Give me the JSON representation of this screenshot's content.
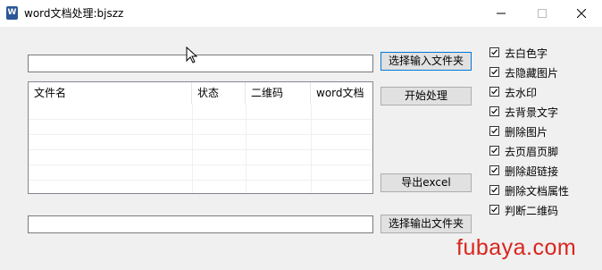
{
  "window": {
    "title": "word文档处理:bjszz",
    "icon": "word-doc-icon",
    "controls": [
      "minimize-icon",
      "maximize-icon",
      "close-icon"
    ]
  },
  "input_folder": {
    "value": "",
    "button_label": "选择输入文件夹"
  },
  "output_folder": {
    "value": "",
    "button_label": "选择输出文件夹"
  },
  "actions": {
    "start_label": "开始处理",
    "export_label": "导出excel"
  },
  "table": {
    "columns": [
      "文件名",
      "状态",
      "二维码",
      "word文档"
    ],
    "rows": []
  },
  "options": [
    {
      "label": "去白色字",
      "checked": true
    },
    {
      "label": "去隐藏图片",
      "checked": true
    },
    {
      "label": "去水印",
      "checked": true
    },
    {
      "label": "去背景文字",
      "checked": true
    },
    {
      "label": "删除图片",
      "checked": true
    },
    {
      "label": "去页眉页脚",
      "checked": true
    },
    {
      "label": "删除超链接",
      "checked": true
    },
    {
      "label": "删除文档属性",
      "checked": true
    },
    {
      "label": "判断二维码",
      "checked": true
    }
  ],
  "watermark": "fubaya.com",
  "colors": {
    "accent": "#0078d7",
    "watermark": "#d9251d"
  }
}
